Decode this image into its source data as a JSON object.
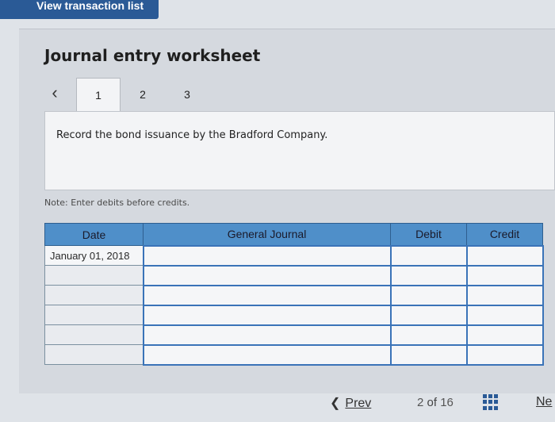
{
  "header": {
    "view_transaction_list": "View transaction list"
  },
  "worksheet": {
    "title": "Journal entry worksheet",
    "tabs": [
      {
        "label": "1"
      },
      {
        "label": "2"
      },
      {
        "label": "3"
      }
    ],
    "active_tab": "1",
    "instruction": "Record the bond issuance by the Bradford Company.",
    "note": "Note: Enter debits before credits."
  },
  "journal_table": {
    "columns": [
      "Date",
      "General Journal",
      "Debit",
      "Credit"
    ],
    "rows": [
      {
        "date": "January 01, 2018",
        "account": "",
        "debit": "",
        "credit": ""
      },
      {
        "date": "",
        "account": "",
        "debit": "",
        "credit": ""
      },
      {
        "date": "",
        "account": "",
        "debit": "",
        "credit": ""
      },
      {
        "date": "",
        "account": "",
        "debit": "",
        "credit": ""
      },
      {
        "date": "",
        "account": "",
        "debit": "",
        "credit": ""
      },
      {
        "date": "",
        "account": "",
        "debit": "",
        "credit": ""
      }
    ]
  },
  "footer": {
    "prev_label": "Prev",
    "page_current": "2",
    "page_of": "of",
    "page_total": "16",
    "next_label": "Ne"
  }
}
